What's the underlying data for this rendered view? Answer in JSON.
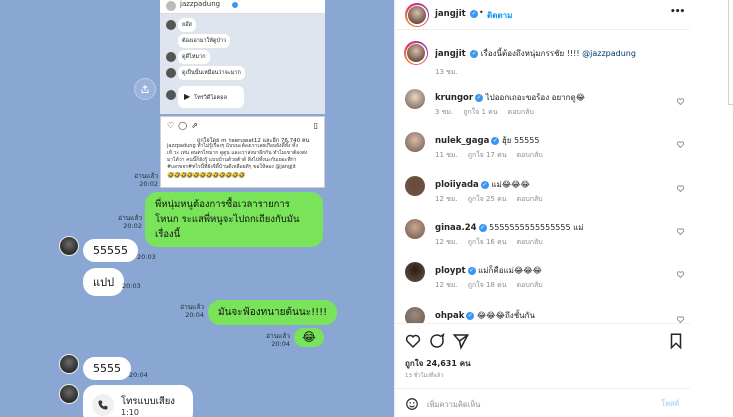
{
  "chat": {
    "screenshot_header_name": "jazzpadung",
    "mini_chat": [
      "ยอ๊ส",
      "ต้องเอามาให้ดูป่าว",
      "ดูดีไหมาก",
      "ดูเป็นนั้นเหมือนว่าจะมาก"
    ],
    "mini_call_label": "โทรวิดีโอคอล",
    "mini_post_likes": "ถูกใจโดย m_teeruwat12 และอีก 76,740 คน",
    "mini_post_caption": "jazzpadung ทำไม่รู้เรื่องๆ แบบนะต้องเราเลยเกือบยังดี้ทั้ง ทั้ง\nเห้ วะ เท่น ดนตรไหมาก ดูดูน และเราส่งมาอีกกัน ทำไมเขาต้องส่ง\nมาได้ว่า คนนี้ก็ยังรู้ แบบบ้านด้วยต้าด้ สิ่งไปทั้งนะกับเยอะพี่ก่า\n#เอกขจร#ทไรนี้ที่ยังจีดี้บ้านดีเหลือยดีๆ ขอให้ลอง @jangjit",
    "mini_post_emoji": "🤣🤣🤣🤣🤣🤣🤣🤣🤣🤣🤣🤣",
    "read_label": "อ่านแล้ว",
    "green_message_1": "พี่หนุ่มหนูต้องการซื้อเวลารายการโหนก ระแสพี่หนูจะไปถกเถียงกับมันเรื่องนี้",
    "time_2002": "20:02",
    "time_2003": "20:03",
    "reply_55555": "55555",
    "reply_pap": "แปป",
    "green_message_2": "มันจะฟ้องทนายต้นนะ!!!!",
    "time_2004": "20:04",
    "laugh_emoji": "😂",
    "reply_5555": "5555",
    "call_title": "โทรแบบเสียง",
    "call_duration": "1:10"
  },
  "post": {
    "author": "jangjit",
    "follow_label": "ติดตาม",
    "more_icon_label": "•••",
    "caption_text": "เรื่องนี้ต้องถึงหนุ่มกรรชัย !!!! ",
    "caption_mention": "@jazzpadung",
    "caption_time": "13 ชม.",
    "reply_label": "ตอบกลับ",
    "comments": [
      {
        "user": "krungor",
        "verified": true,
        "text": "ไปออกเถอะขอร้อง อยากดู😂",
        "time": "3 ชม.",
        "likes": "ถูกใจ 1 คน",
        "avatar": "#e8d6c4"
      },
      {
        "user": "nulek_gaga",
        "verified": true,
        "text": "ฮุ้ย 55555",
        "time": "11 ชม.",
        "likes": "ถูกใจ 17 คน",
        "avatar": "#d8b9a8"
      },
      {
        "user": "ploiiyada",
        "verified": true,
        "text": "แม่😂😂😂",
        "time": "12 ชม.",
        "likes": "ถูกใจ 25 คน",
        "avatar": "#6a4a3a"
      },
      {
        "user": "ginaa.24",
        "verified": true,
        "text": "5555555555555555 แม่",
        "time": "12 ชม.",
        "likes": "ถูกใจ 16 คน",
        "avatar": "#c9a690"
      },
      {
        "user": "ploypt",
        "verified": true,
        "text": "แม่ก็คือแม่😂😂😂",
        "time": "12 ชม.",
        "likes": "ถูกใจ 18 คน",
        "avatar": "#2a1e16"
      },
      {
        "user": "ohpak",
        "verified": true,
        "text": "😂😂😂ถึงชั้นกัน",
        "time": "",
        "likes": "",
        "avatar": "#9a8a80"
      }
    ],
    "likes_total": "ถูกใจ 24,631 คน",
    "posted_ago": "13 ชั่วโมงที่แล้ว",
    "comment_placeholder": "เพิ่มความคิดเห็น",
    "post_button": "โพสต์"
  },
  "colors": {
    "line_green": "#79e45a",
    "chat_bg": "#8aa6d2",
    "ig_blue": "#0095f6",
    "verified": "#3897f0"
  }
}
